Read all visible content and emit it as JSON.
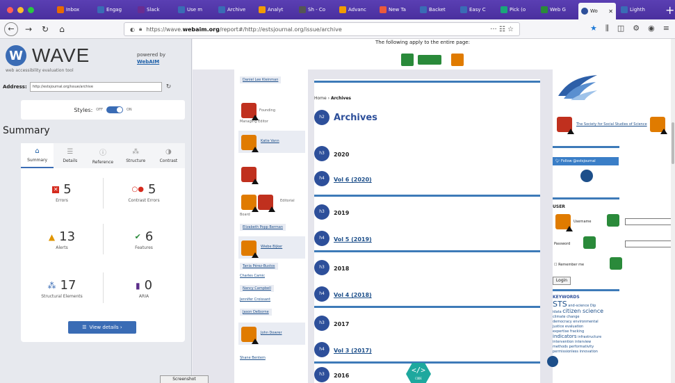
{
  "browser": {
    "tabs": [
      {
        "label": "Inbox",
        "color": "#e86a00"
      },
      {
        "label": "Engag",
        "color": "#3a6cb5"
      },
      {
        "label": "Slack",
        "color": "#6a2c91"
      },
      {
        "label": "Use m",
        "color": "#3a6cb5"
      },
      {
        "label": "Archive",
        "color": "#3a6cb5"
      },
      {
        "label": "Analyt",
        "color": "#f29b00"
      },
      {
        "label": "Sh - Co",
        "color": "#555"
      },
      {
        "label": "Advanc",
        "color": "#f29b00"
      },
      {
        "label": "New Ta",
        "color": "#ec5a3b"
      },
      {
        "label": "Backet",
        "color": "#3a6cb5"
      },
      {
        "label": "Easy C",
        "color": "#3a6cb5"
      },
      {
        "label": "Pick (o",
        "color": "#1aa67a"
      },
      {
        "label": "Web G",
        "color": "#2a8a3a"
      },
      {
        "label": "Wo",
        "color": "#2d4f9a",
        "active": true
      },
      {
        "label": "Lighth",
        "color": "#3a6cb5"
      }
    ],
    "url_prefix": "https://wave.",
    "url_domain": "webaim.org",
    "url_rest": "/report#/http://estsjournal.org/issue/archive",
    "url_tail": "··· ☷ ☆"
  },
  "wave": {
    "logo_letter": "W",
    "logo_word": "WAVE",
    "tagline": "web accessibility evaluation tool",
    "powered_by": "powered by",
    "webaim": "WebAIM",
    "address_label": "Address:",
    "address_value": "http://estsjournal.org/issue/archive",
    "styles_label": "Styles:",
    "styles_off": "OFF",
    "styles_on": "ON",
    "summary_heading": "Summary",
    "tabs": [
      "Summary",
      "Details",
      "Reference",
      "Structure",
      "Contrast"
    ],
    "stats": {
      "errors": {
        "value": "5",
        "label": "Errors"
      },
      "contrast": {
        "value": "5",
        "label": "Contrast Errors"
      },
      "alerts": {
        "value": "13",
        "label": "Alerts"
      },
      "features": {
        "value": "6",
        "label": "Features"
      },
      "structural": {
        "value": "17",
        "label": "Structural Elements"
      },
      "aria": {
        "value": "0",
        "label": "ARIA"
      }
    },
    "view_details": "View details ›"
  },
  "page": {
    "banner": "The following apply to the entire page:",
    "breadcrumb_home": "Home",
    "breadcrumb_sep": " › ",
    "breadcrumb_current": "Archives",
    "title": "Archives",
    "years": [
      {
        "year": "2020",
        "vol": "Vol 6 (2020)"
      },
      {
        "year": "2019",
        "vol": "Vol 5 (2019)"
      },
      {
        "year": "2018",
        "vol": "Vol 4 (2018)"
      },
      {
        "year": "2017",
        "vol": "Vol 3 (2017)"
      },
      {
        "year": "2016",
        "vol": ""
      }
    ],
    "left_names": {
      "daniel": "Daniel Lee Kleinman",
      "founding": "Founding",
      "managing": "Managing Editor",
      "katie": "Katie Vann",
      "editorial": "Editorial",
      "board": "Board",
      "elizabeth": "Elizabeth Popp Berman",
      "wiebe": "Wiebe Bijker",
      "tania": "Tania Pérez-Bustos",
      "charles": "Charles Camic",
      "nancy": "Nancy Campbell",
      "jennifer": "Jennifer Croissant",
      "jason": "Jason Delborne",
      "john": "John Dowrer",
      "extra": "Shane Bentem"
    },
    "right": {
      "society": "The Society for Social Studies of Science",
      "twitter": "Follow @estsjournal",
      "user_heading": "USER",
      "username": "Username",
      "password": "Password",
      "remember": "Remember me",
      "login": "Login",
      "keywords_heading": "KEYWORDS",
      "kw_sts": "STS",
      "kw_1": "and-science Dip",
      "kw_2": "idata",
      "kw_citizen": "citizen science",
      "kw_3": "climate change",
      "kw_4": "democracy environmental",
      "kw_5": "justice evaluation",
      "kw_6": "expertise fracking",
      "kw_indicators": "indicators",
      "kw_7": "infrastructure",
      "kw_8": "intervention interview",
      "kw_9": "methods performativity",
      "kw_10": "permissionless innovation"
    }
  },
  "overlay": {
    "screenshot_tip": "Screenshot",
    "code_label": "</>",
    "code_sub": "CODE"
  }
}
